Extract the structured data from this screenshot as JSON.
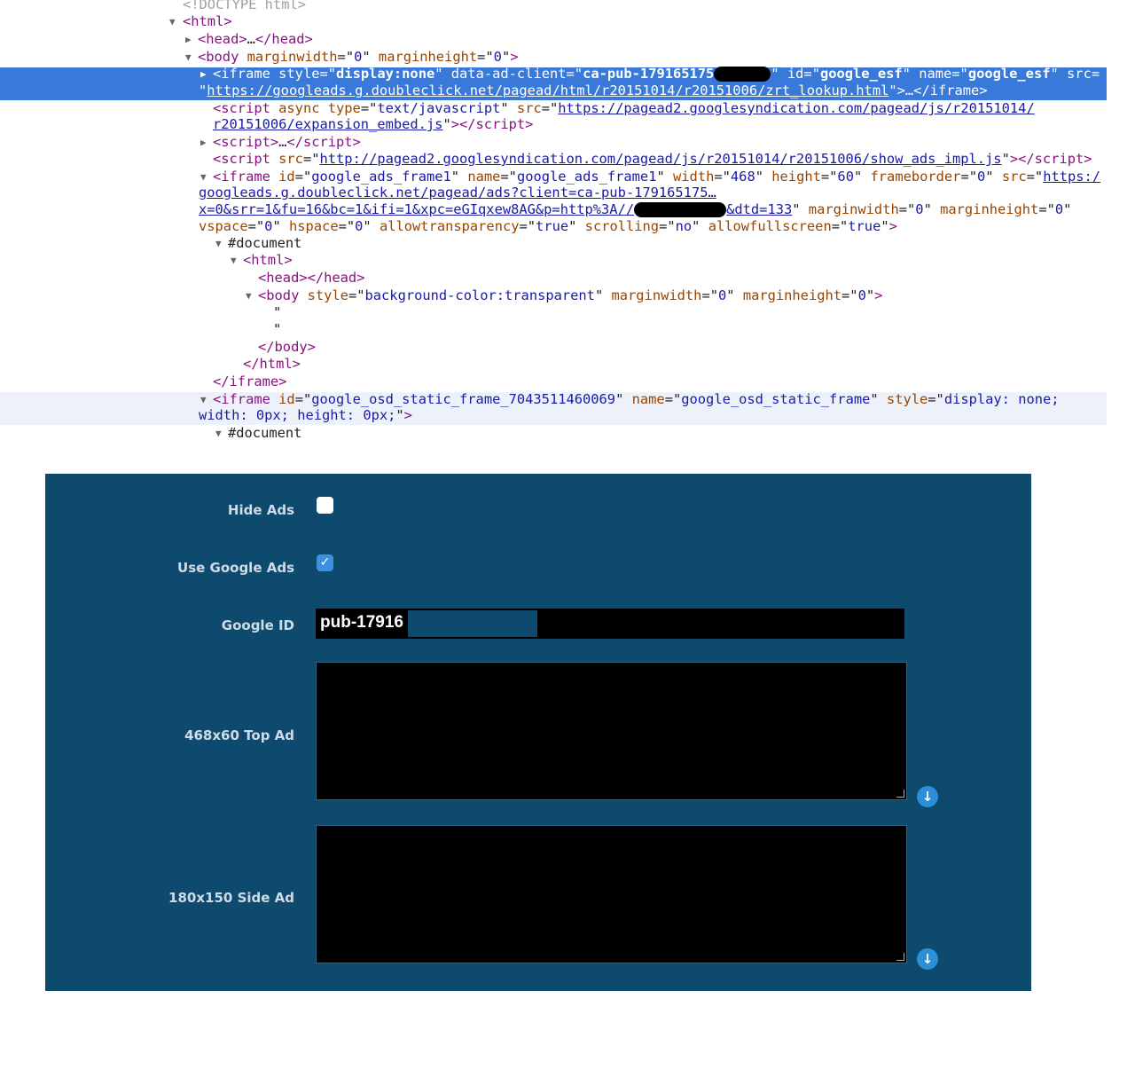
{
  "devtools": {
    "lines": [
      [
        [
          "gray",
          "<!DOCTYPE html>"
        ]
      ],
      [
        [
          "tag",
          "<html>"
        ]
      ],
      [
        [
          "tag",
          "<head>"
        ],
        [
          "text",
          "…"
        ],
        [
          "tag",
          "</head>"
        ]
      ],
      [
        [
          "tag",
          "<body "
        ],
        [
          "attr",
          "marginwidth"
        ],
        [
          "text",
          "=\""
        ],
        [
          "val",
          "0"
        ],
        [
          "text",
          "\" "
        ],
        [
          "attr",
          "marginheight"
        ],
        [
          "text",
          "=\""
        ],
        [
          "val",
          "0"
        ],
        [
          "text",
          "\""
        ],
        [
          "tag",
          ">"
        ]
      ],
      [
        [
          "tag",
          "<iframe "
        ],
        [
          "attr",
          "style"
        ],
        [
          "text",
          "=\""
        ],
        [
          "bold",
          "display:none"
        ],
        [
          "text",
          "\" "
        ],
        [
          "attr",
          "data-ad-client"
        ],
        [
          "text",
          "=\""
        ],
        [
          "bold",
          "ca-pub-179165175"
        ],
        [
          "blob",
          ""
        ],
        [
          "text",
          "\" "
        ],
        [
          "attr",
          "id"
        ],
        [
          "text",
          "=\""
        ],
        [
          "bold",
          "google_esf"
        ],
        [
          "text",
          "\" "
        ],
        [
          "attr",
          "name"
        ],
        [
          "text",
          "=\""
        ],
        [
          "bold",
          "google_esf"
        ],
        [
          "text",
          "\" "
        ],
        [
          "attr",
          "src="
        ]
      ],
      [
        [
          "text",
          "\""
        ],
        [
          "link",
          "https://googleads.g.doubleclick.net/pagead/html/r20151014/r20151006/zrt_lookup.html"
        ],
        [
          "text",
          "\">…"
        ],
        [
          "tag",
          "</iframe>"
        ]
      ],
      [
        [
          "tag",
          "<script "
        ],
        [
          "attr",
          "async "
        ],
        [
          "attr",
          "type"
        ],
        [
          "text",
          "=\""
        ],
        [
          "val",
          "text/javascript"
        ],
        [
          "text",
          "\" "
        ],
        [
          "attr",
          "src"
        ],
        [
          "text",
          "=\""
        ],
        [
          "link",
          "https://pagead2.googlesyndication.com/pagead/js/r20151014/"
        ]
      ],
      [
        [
          "link",
          "r20151006/expansion_embed.js"
        ],
        [
          "text",
          "\""
        ],
        [
          "tag",
          "></script>"
        ]
      ],
      [
        [
          "tag",
          "<script>"
        ],
        [
          "text",
          "…"
        ],
        [
          "tag",
          "</script>"
        ]
      ],
      [
        [
          "tag",
          "<script "
        ],
        [
          "attr",
          "src"
        ],
        [
          "text",
          "=\""
        ],
        [
          "link",
          "http://pagead2.googlesyndication.com/pagead/js/r20151014/r20151006/show_ads_impl.js"
        ],
        [
          "text",
          "\""
        ],
        [
          "tag",
          "></script>"
        ]
      ],
      [
        [
          "tag",
          "<iframe "
        ],
        [
          "attr",
          "id"
        ],
        [
          "text",
          "=\""
        ],
        [
          "val",
          "google_ads_frame1"
        ],
        [
          "text",
          "\" "
        ],
        [
          "attr",
          "name"
        ],
        [
          "text",
          "=\""
        ],
        [
          "val",
          "google_ads_frame1"
        ],
        [
          "text",
          "\" "
        ],
        [
          "attr",
          "width"
        ],
        [
          "text",
          "=\""
        ],
        [
          "val",
          "468"
        ],
        [
          "text",
          "\" "
        ],
        [
          "attr",
          "height"
        ],
        [
          "text",
          "=\""
        ],
        [
          "val",
          "60"
        ],
        [
          "text",
          "\" "
        ],
        [
          "attr",
          "frameborder"
        ],
        [
          "text",
          "=\""
        ],
        [
          "val",
          "0"
        ],
        [
          "text",
          "\" "
        ],
        [
          "attr",
          "src"
        ],
        [
          "text",
          "=\""
        ],
        [
          "link",
          "https:/"
        ]
      ],
      [
        [
          "link",
          "googleads.g.doubleclick.net/pagead/ads?client=ca-pub-179165175…"
        ]
      ],
      [
        [
          "link",
          "x=0&srr=1&fu=16&bc=1&ifi=1&xpc=eGIqxew8AG&p=http%3A//"
        ],
        [
          "blob",
          ""
        ],
        [
          "link",
          "&dtd=133"
        ],
        [
          "text",
          "\" "
        ],
        [
          "attr",
          "marginwidth"
        ],
        [
          "text",
          "=\""
        ],
        [
          "val",
          "0"
        ],
        [
          "text",
          "\" "
        ],
        [
          "attr",
          "marginheight"
        ],
        [
          "text",
          "=\""
        ],
        [
          "val",
          "0"
        ],
        [
          "text",
          "\""
        ]
      ],
      [
        [
          "attr",
          "vspace"
        ],
        [
          "text",
          "=\""
        ],
        [
          "val",
          "0"
        ],
        [
          "text",
          "\" "
        ],
        [
          "attr",
          "hspace"
        ],
        [
          "text",
          "=\""
        ],
        [
          "val",
          "0"
        ],
        [
          "text",
          "\" "
        ],
        [
          "attr",
          "allowtransparency"
        ],
        [
          "text",
          "=\""
        ],
        [
          "val",
          "true"
        ],
        [
          "text",
          "\" "
        ],
        [
          "attr",
          "scrolling"
        ],
        [
          "text",
          "=\""
        ],
        [
          "val",
          "no"
        ],
        [
          "text",
          "\" "
        ],
        [
          "attr",
          "allowfullscreen"
        ],
        [
          "text",
          "=\""
        ],
        [
          "val",
          "true"
        ],
        [
          "text",
          "\""
        ],
        [
          "tag",
          ">"
        ]
      ],
      [
        [
          "text",
          "#document"
        ]
      ],
      [
        [
          "tag",
          "<html>"
        ]
      ],
      [
        [
          "tag",
          "<head></head>"
        ]
      ],
      [
        [
          "tag",
          "<body "
        ],
        [
          "attr",
          "style"
        ],
        [
          "text",
          "=\""
        ],
        [
          "val",
          "background-color:transparent"
        ],
        [
          "text",
          "\" "
        ],
        [
          "attr",
          "marginwidth"
        ],
        [
          "text",
          "=\""
        ],
        [
          "val",
          "0"
        ],
        [
          "text",
          "\" "
        ],
        [
          "attr",
          "marginheight"
        ],
        [
          "text",
          "=\""
        ],
        [
          "val",
          "0"
        ],
        [
          "text",
          "\""
        ],
        [
          "tag",
          ">"
        ]
      ],
      [
        [
          "text",
          "\""
        ]
      ],
      [
        [
          "text",
          "\""
        ]
      ],
      [
        [
          "tag",
          "</body>"
        ]
      ],
      [
        [
          "tag",
          "</html>"
        ]
      ],
      [
        [
          "tag",
          "</iframe>"
        ]
      ],
      [
        [
          "tag",
          "<iframe "
        ],
        [
          "attr",
          "id"
        ],
        [
          "text",
          "=\""
        ],
        [
          "val",
          "google_osd_static_frame_7043511460069"
        ],
        [
          "text",
          "\" "
        ],
        [
          "attr",
          "name"
        ],
        [
          "text",
          "=\""
        ],
        [
          "val",
          "google_osd_static_frame"
        ],
        [
          "text",
          "\" "
        ],
        [
          "attr",
          "style"
        ],
        [
          "text",
          "=\""
        ],
        [
          "val",
          "display: none;"
        ]
      ],
      [
        [
          "val",
          "width: 0px; height: 0px;"
        ],
        [
          "text",
          "\""
        ],
        [
          "tag",
          ">"
        ]
      ],
      [
        [
          "text",
          "#document"
        ]
      ]
    ]
  },
  "form": {
    "hide_ads_label": "Hide Ads",
    "hide_ads_checked": false,
    "use_google_ads_label": "Use Google Ads",
    "use_google_ads_checked": true,
    "google_id_label": "Google ID",
    "google_id_value": "pub-17916",
    "top_ad_label": "468x60 Top Ad",
    "side_ad_label": "180x150 Side Ad"
  },
  "colors": {
    "panel": "#0e4a6e",
    "selection": "#3879d9",
    "accent": "#2b8fd9"
  }
}
